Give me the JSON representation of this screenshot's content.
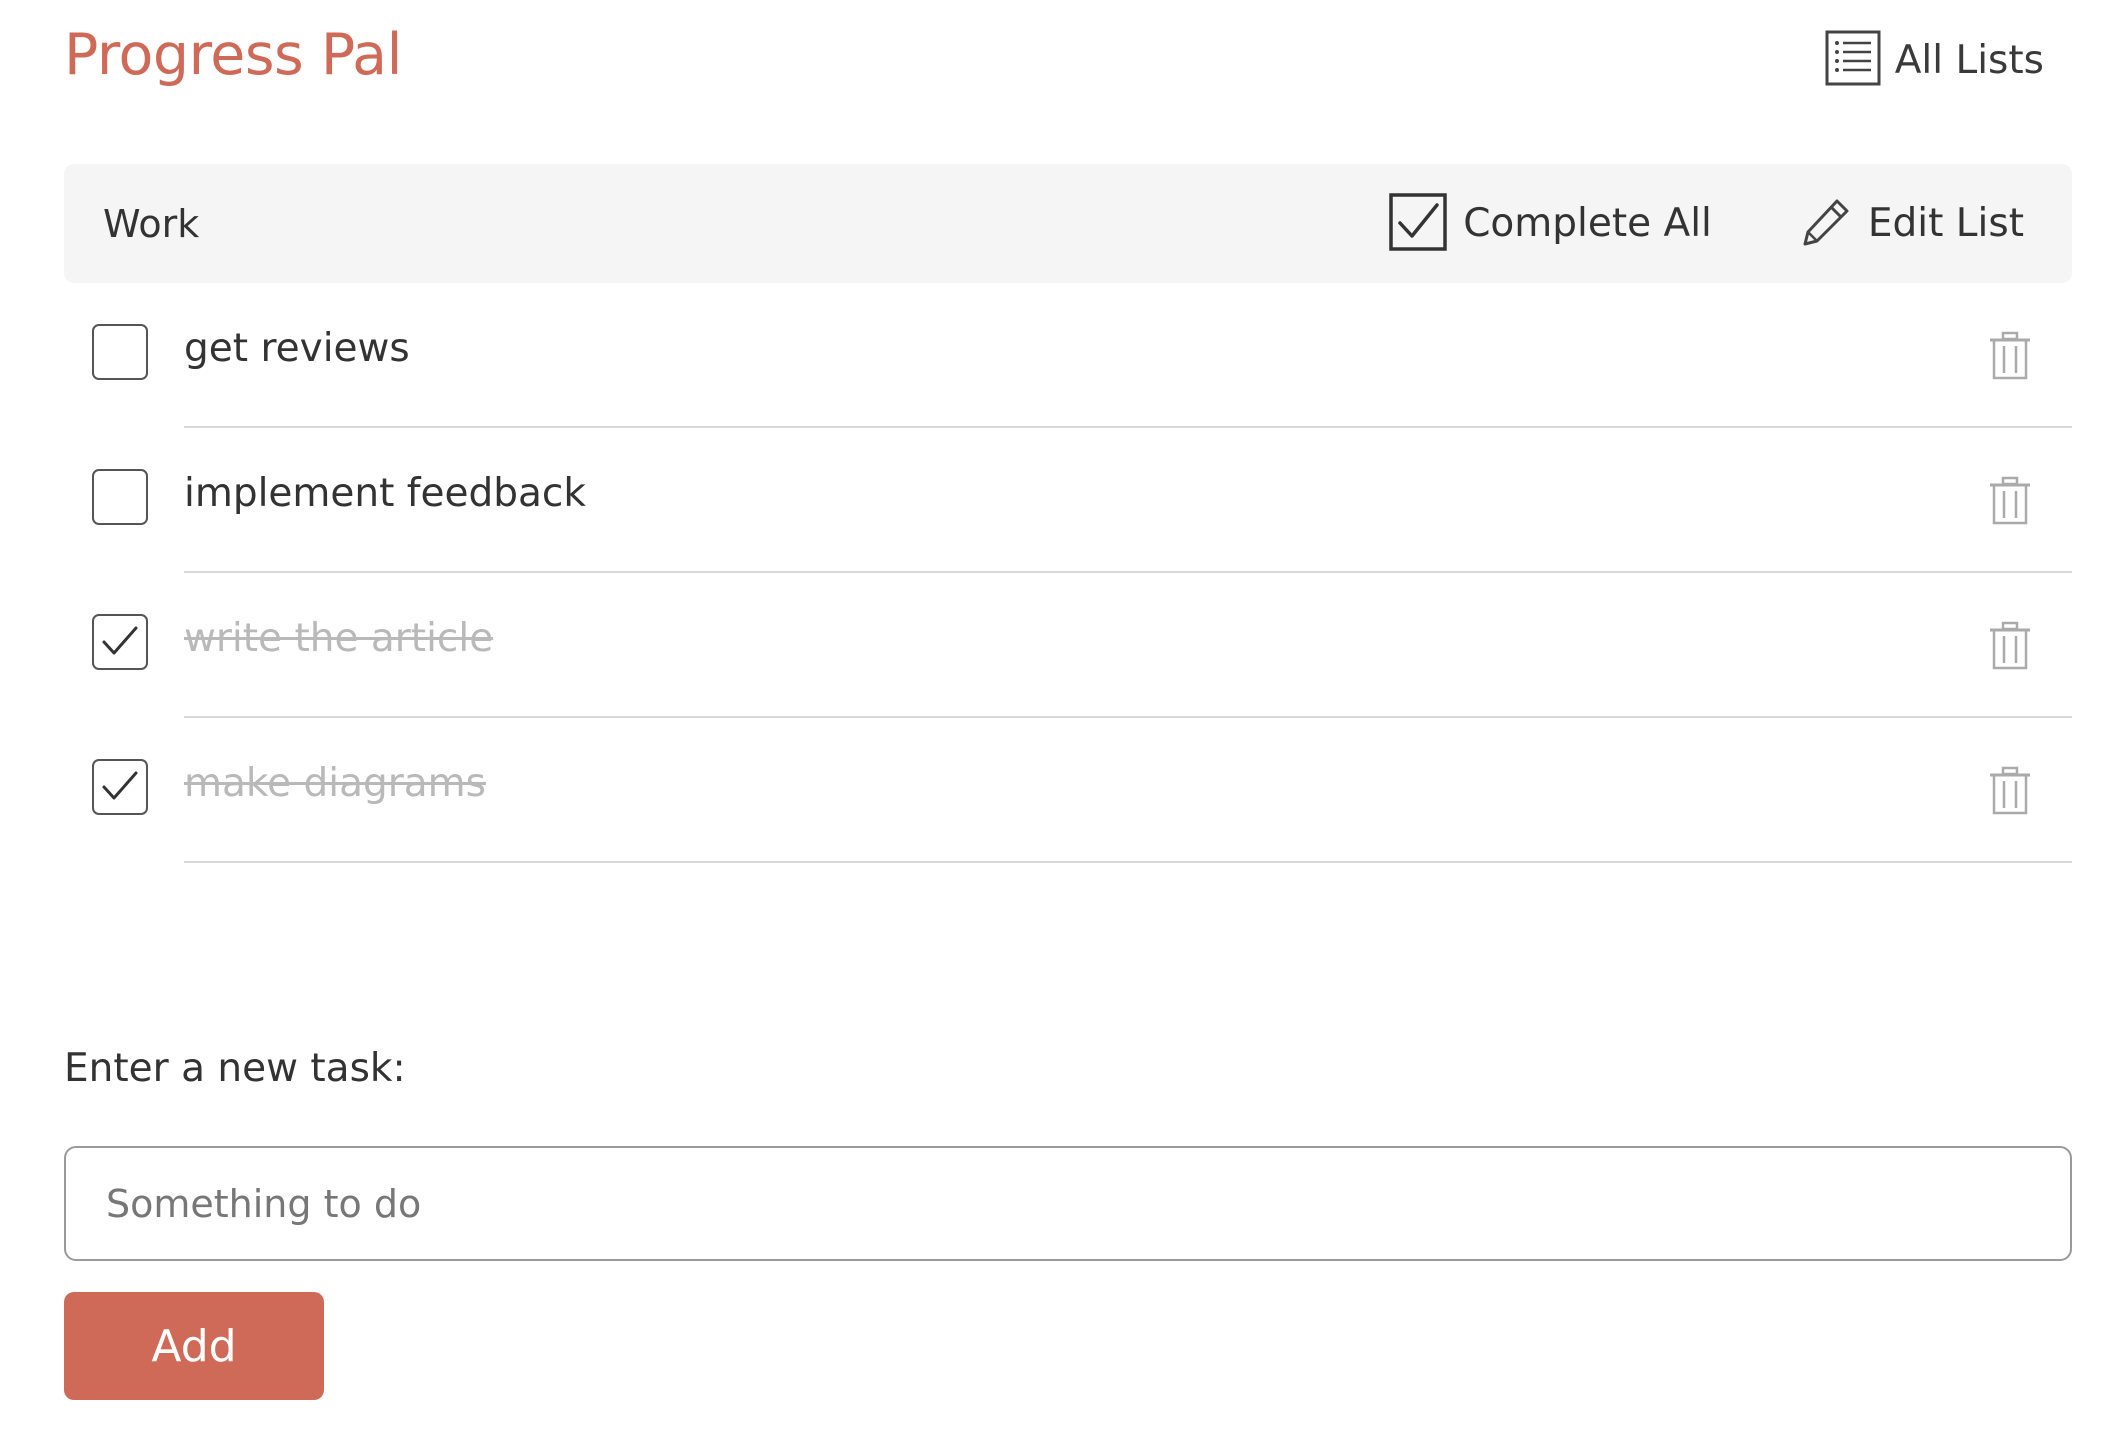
{
  "app": {
    "title": "Progress Pal",
    "accent_color": "#d06a58"
  },
  "header": {
    "all_lists_label": "All Lists",
    "all_lists_icon": "list-icon"
  },
  "list": {
    "name": "Work",
    "complete_all_label": "Complete All",
    "complete_all_icon": "checkbox-checked-icon",
    "edit_label": "Edit List",
    "edit_icon": "pencil-icon"
  },
  "tasks": [
    {
      "text": "get reviews",
      "done": false
    },
    {
      "text": "implement feedback",
      "done": false
    },
    {
      "text": "write the article",
      "done": true
    },
    {
      "text": "make diagrams",
      "done": true
    }
  ],
  "new_task": {
    "label": "Enter a new task:",
    "placeholder": "Something to do",
    "value": "",
    "add_label": "Add"
  }
}
